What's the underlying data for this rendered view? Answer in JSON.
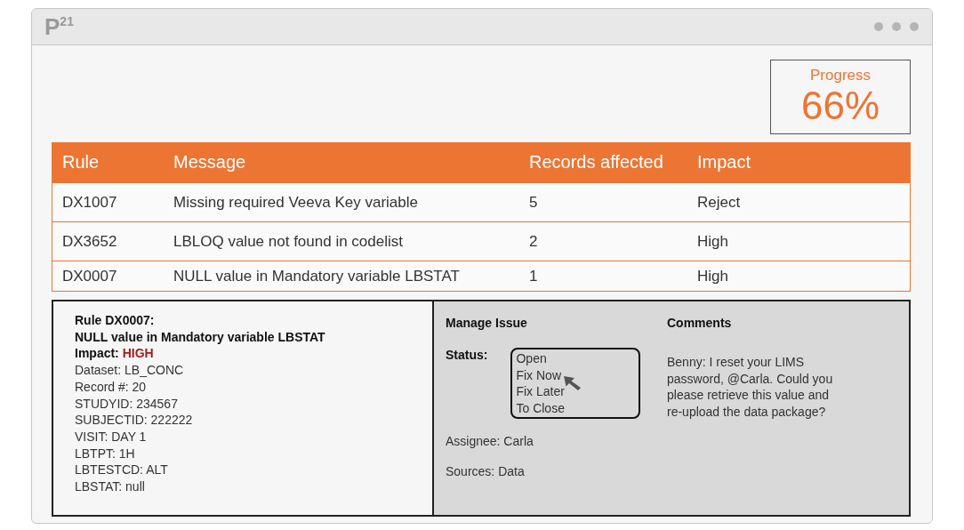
{
  "window": {
    "logo": "P$^{21}$"
  },
  "progress": {
    "label": "Progress",
    "value": "66%"
  },
  "table": {
    "columns": [
      "Rule",
      "Message",
      "Records affected",
      "Impact"
    ],
    "rows": [
      {
        "cells": [
          "DX1007",
          "Missing required Veeva Key variable",
          "5",
          "Reject"
        ]
      },
      {
        "cells": [
          "DX3652",
          "LBLOQ value not found in codelist",
          "2",
          "High"
        ]
      },
      {
        "cells": [
          "DX0007",
          "NULL value in Mandatory variable LBSTAT",
          "1",
          "High"
        ]
      }
    ]
  },
  "detail": {
    "title_lines": [
      "Rule DX0007:",
      "NULL value in Mandatory variable LBSTAT"
    ],
    "impact_label": "Impact:",
    "impact_value": "HIGH",
    "fields": [
      "Dataset: LB_CONC",
      "Record #: 20",
      "STUDYID: 234567",
      "SUBJECTID: 222222",
      "VISIT: DAY 1",
      "LBTPT: 1H",
      "LBTESTCD: ALT",
      "LBSTAT: null"
    ]
  },
  "manage": {
    "title": "Manage Issue",
    "status_label": "Status:",
    "status_options": [
      {
        "label": "Open",
        "hovered": false
      },
      {
        "label": "Fix Now",
        "hovered": true
      },
      {
        "label": "Fix Later",
        "hovered": false
      },
      {
        "label": "To Close",
        "hovered": false
      }
    ],
    "assignee": "Assignee: Carla",
    "sources": "Sources: Data"
  },
  "comments": {
    "title": "Comments",
    "text": "Benny: I reset your LIMS password, @Carla. Could you please retrieve this value and re-upload the data package?"
  }
}
